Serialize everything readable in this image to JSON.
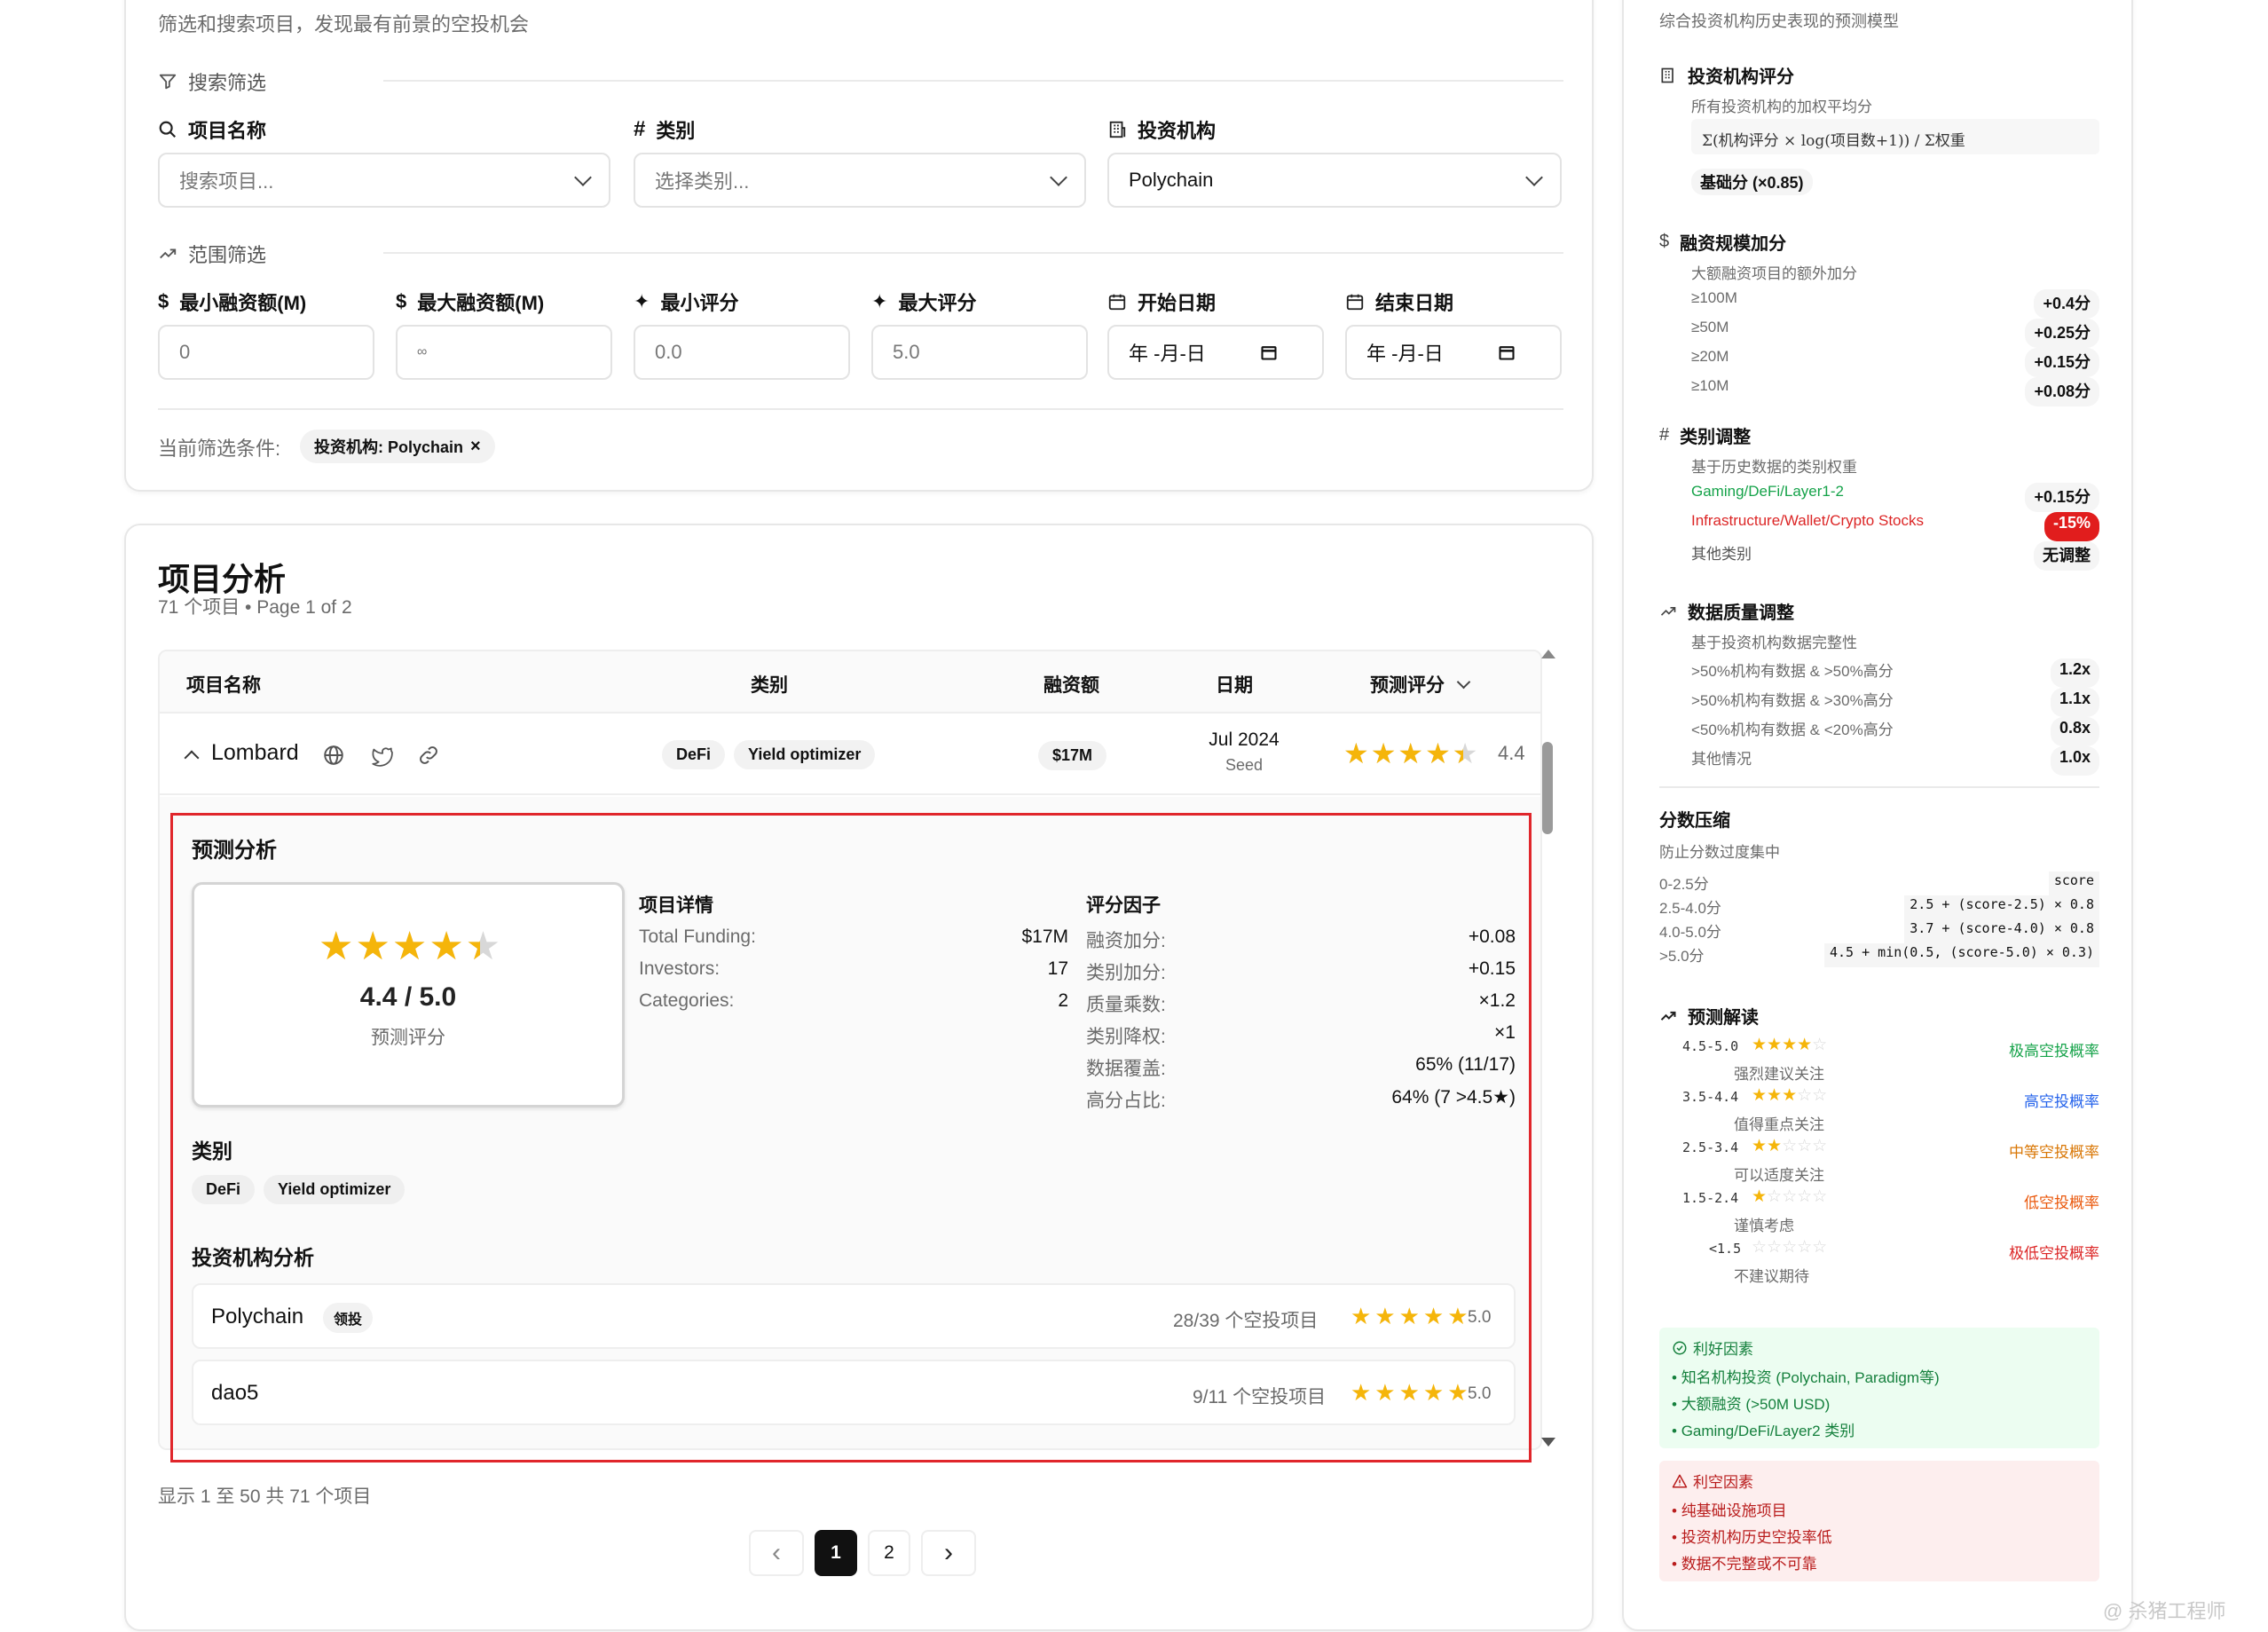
{
  "filter_card": {
    "subtitle": "筛选和搜索项目，发现最有前景的空投机会",
    "search_section": "搜索筛选",
    "fields": [
      {
        "label": "项目名称",
        "placeholder": "搜索项目...",
        "value": ""
      },
      {
        "label": "类别",
        "placeholder": "选择类别...",
        "value": ""
      },
      {
        "label": "投资机构",
        "placeholder": "",
        "value": "Polychain"
      }
    ],
    "range_section": "范围筛选",
    "range_fields": [
      {
        "label": "最小融资额(M)",
        "value": "0"
      },
      {
        "label": "最大融资额(M)",
        "value": "∞"
      },
      {
        "label": "最小评分",
        "value": "0.0"
      },
      {
        "label": "最大评分",
        "value": "5.0"
      },
      {
        "label": "开始日期",
        "value": "年 -月-日"
      },
      {
        "label": "结束日期",
        "value": "年 -月-日"
      }
    ],
    "current_filters_label": "当前筛选条件:",
    "active_filter": "投资机构: Polychain",
    "active_filter_remove": "×"
  },
  "analysis": {
    "title": "项目分析",
    "subtitle": "71 个项目 • Page 1 of 2",
    "columns": [
      "项目名称",
      "类别",
      "融资额",
      "日期",
      "预测评分"
    ],
    "row": {
      "name": "Lombard",
      "categories": [
        "DeFi",
        "Yield optimizer"
      ],
      "funding": "$17M",
      "date": "Jul 2024",
      "round": "Seed",
      "score": "4.4",
      "rating_fraction": 0.88
    },
    "detail": {
      "title": "预测分析",
      "score_text": "4.4 / 5.0",
      "score_label": "预测评分",
      "project_details_title": "项目详情",
      "project_details": [
        {
          "k": "Total Funding:",
          "v": "$17M"
        },
        {
          "k": "Investors:",
          "v": "17"
        },
        {
          "k": "Categories:",
          "v": "2"
        }
      ],
      "factors_title": "评分因子",
      "factors": [
        {
          "k": "融资加分:",
          "v": "+0.08"
        },
        {
          "k": "类别加分:",
          "v": "+0.15"
        },
        {
          "k": "质量乘数:",
          "v": "×1.2"
        },
        {
          "k": "类别降权:",
          "v": "×1"
        },
        {
          "k": "数据覆盖:",
          "v": "65% (11/17)"
        },
        {
          "k": "高分占比:",
          "v": "64% (7 >4.5★)"
        }
      ],
      "categories_title": "类别",
      "categories": [
        "DeFi",
        "Yield optimizer"
      ],
      "investors_title": "投资机构分析",
      "investors": [
        {
          "name": "Polychain",
          "badge": "领投",
          "stat": "28/39 个空投项目",
          "score": "5.0"
        },
        {
          "name": "dao5",
          "badge": "",
          "stat": "9/11 个空投项目",
          "score": "5.0"
        }
      ]
    },
    "footer": "显示 1 至 50 共 71 个项目",
    "pages": [
      "1",
      "2"
    ],
    "prev": "‹",
    "next": "›"
  },
  "sidebar": {
    "subtitle": "综合投资机构历史表现的预测模型",
    "s1_title": "投资机构评分",
    "s1_desc": "所有投资机构的加权平均分",
    "s1_formula": "Σ(机构评分 × log(项目数+1)) / Σ权重",
    "s1_badge": "基础分 (×0.85)",
    "s2_title": "融资规模加分",
    "s2_desc": "大额融资项目的额外加分",
    "s2_rows": [
      {
        "k": "≥100M",
        "v": "+0.4分"
      },
      {
        "k": "≥50M",
        "v": "+0.25分"
      },
      {
        "k": "≥20M",
        "v": "+0.15分"
      },
      {
        "k": "≥10M",
        "v": "+0.08分"
      }
    ],
    "s3_title": "类别调整",
    "s3_desc": "基于历史数据的类别权重",
    "s3_rows": [
      {
        "k": "Gaming/DeFi/Layer1-2",
        "v": "+0.15分",
        "color": "#16a34a"
      },
      {
        "k": "Infrastructure/Wallet/Crypto Stocks",
        "v": "-15%",
        "color": "#dc2626"
      },
      {
        "k": "其他类别",
        "v": "无调整",
        "color": "#555555"
      }
    ],
    "s4_title": "数据质量调整",
    "s4_desc": "基于投资机构数据完整性",
    "s4_rows": [
      {
        "k": ">50%机构有数据 & >50%高分",
        "v": "1.2x"
      },
      {
        "k": ">50%机构有数据 & >30%高分",
        "v": "1.1x"
      },
      {
        "k": "<50%机构有数据 & <20%高分",
        "v": "0.8x"
      },
      {
        "k": "其他情况",
        "v": "1.0x"
      }
    ],
    "s5_title": "分数压缩",
    "s5_desc": "防止分数过度集中",
    "s5_rows": [
      {
        "k": "0-2.5分",
        "v": "score"
      },
      {
        "k": "2.5-4.0分",
        "v": "2.5 + (score-2.5) × 0.8"
      },
      {
        "k": "4.0-5.0分",
        "v": "3.7 + (score-4.0) × 0.8"
      },
      {
        "k": ">5.0分",
        "v": "4.5 + min(0.5, (score-5.0) × 0.3)"
      }
    ],
    "s6_title": "预测解读",
    "s6_rows": [
      {
        "range": "4.5-5.0",
        "stars": 4.5,
        "desc": "强烈建议关注",
        "tag": "极高空投概率",
        "color": "#16a34a"
      },
      {
        "range": "3.5-4.4",
        "stars": 3.5,
        "desc": "值得重点关注",
        "tag": "高空投概率",
        "color": "#2563eb"
      },
      {
        "range": "2.5-3.4",
        "stars": 2.5,
        "desc": "可以适度关注",
        "tag": "中等空投概率",
        "color": "#d97706"
      },
      {
        "range": "1.5-2.4",
        "stars": 1.5,
        "desc": "谨慎考虑",
        "tag": "低空投概率",
        "color": "#ea580c"
      },
      {
        "range": "<1.5",
        "stars": 0,
        "desc": "不建议期待",
        "tag": "极低空投概率",
        "color": "#dc2626"
      }
    ],
    "pos_title": "利好因素",
    "pos_items": [
      "知名机构投资 (Polychain, Paradigm等)",
      "大额融资 (>50M USD)",
      "Gaming/DeFi/Layer2 类别"
    ],
    "neg_title": "利空因素",
    "neg_items": [
      "纯基础设施项目",
      "投资机构历史空投率低",
      "数据不完整或不可靠"
    ]
  },
  "watermark": "@ 杀猪工程师"
}
